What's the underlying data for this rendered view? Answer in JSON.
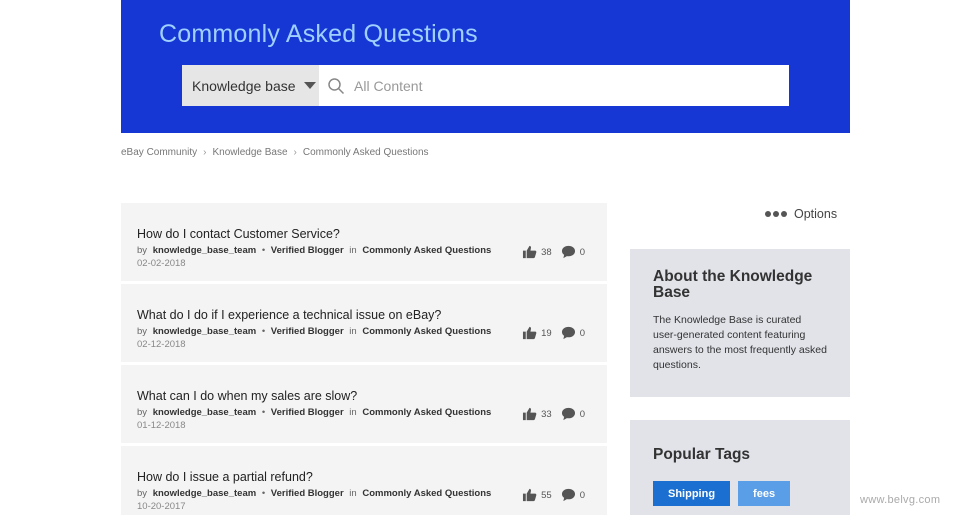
{
  "header": {
    "title": "Commonly Asked Questions",
    "scope_label": "Knowledge base",
    "search_placeholder": "All Content",
    "background": "#1737d4"
  },
  "breadcrumb": [
    "eBay Community",
    "Knowledge Base",
    "Commonly Asked Questions"
  ],
  "options_label": "Options",
  "articles": [
    {
      "title": "How do I contact Customer Service?",
      "author": "knowledge_base_team",
      "rank": "Verified Blogger",
      "in_label": "in",
      "board": "Commonly Asked Questions",
      "by_label": "by",
      "date": "02-02-2018",
      "kudos": "38",
      "comments": "0"
    },
    {
      "title": "What do I do if I experience a technical issue on eBay?",
      "author": "knowledge_base_team",
      "rank": "Verified Blogger",
      "in_label": "in",
      "board": "Commonly Asked Questions",
      "by_label": "by",
      "date": "02-12-2018",
      "kudos": "19",
      "comments": "0"
    },
    {
      "title": "What can I do when my sales are slow?",
      "author": "knowledge_base_team",
      "rank": "Verified Blogger",
      "in_label": "in",
      "board": "Commonly Asked Questions",
      "by_label": "by",
      "date": "01-12-2018",
      "kudos": "33",
      "comments": "0"
    },
    {
      "title": "How do I issue a partial refund?",
      "author": "knowledge_base_team",
      "rank": "Verified Blogger",
      "in_label": "in",
      "board": "Commonly Asked Questions",
      "by_label": "by",
      "date": "10-20-2017",
      "kudos": "55",
      "comments": "0"
    }
  ],
  "about": {
    "title": "About the Knowledge Base",
    "body": "The Knowledge Base is curated user-generated content featuring answers to the most frequently asked questions."
  },
  "popular_tags": {
    "title": "Popular Tags",
    "tags": [
      "Shipping",
      "fees"
    ]
  },
  "watermark": "www.belvg.com"
}
